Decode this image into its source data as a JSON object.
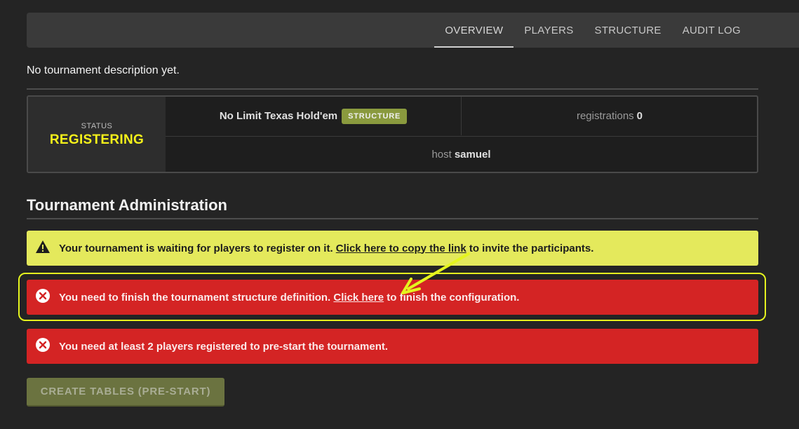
{
  "nav": {
    "tabs": [
      {
        "label": "OVERVIEW",
        "active": true
      },
      {
        "label": "PLAYERS"
      },
      {
        "label": "STRUCTURE"
      },
      {
        "label": "AUDIT LOG"
      }
    ]
  },
  "description": "No tournament description yet.",
  "info": {
    "status_label": "STATUS",
    "status_value": "REGISTERING",
    "game": "No Limit Texas Hold'em",
    "structure_badge": "STRUCTURE",
    "registrations_label": "registrations",
    "registrations_count": "0",
    "host_label": "host",
    "host_name": "samuel"
  },
  "admin": {
    "title": "Tournament Administration",
    "warning": {
      "before": "Your tournament is waiting for players to register on it. ",
      "link": "Click here to copy the link",
      "after": " to invite the participants."
    },
    "error_structure": {
      "before": "You need to finish the tournament structure definition. ",
      "link": "Click here",
      "after": " to finish the configuration."
    },
    "error_players": "You need at least 2 players registered to pre-start the tournament.",
    "create_tables_button": "CREATE TABLES (PRE-START)"
  },
  "colors": {
    "status_accent": "#f6f21a",
    "warning_bg": "#e4e95c",
    "error_bg": "#d42424",
    "highlight": "#e5f51e",
    "button_bg": "#6b7340"
  },
  "icons": {
    "warning": "warning-triangle-icon",
    "error": "x-circle-icon",
    "annotation": "arrow-icon"
  }
}
